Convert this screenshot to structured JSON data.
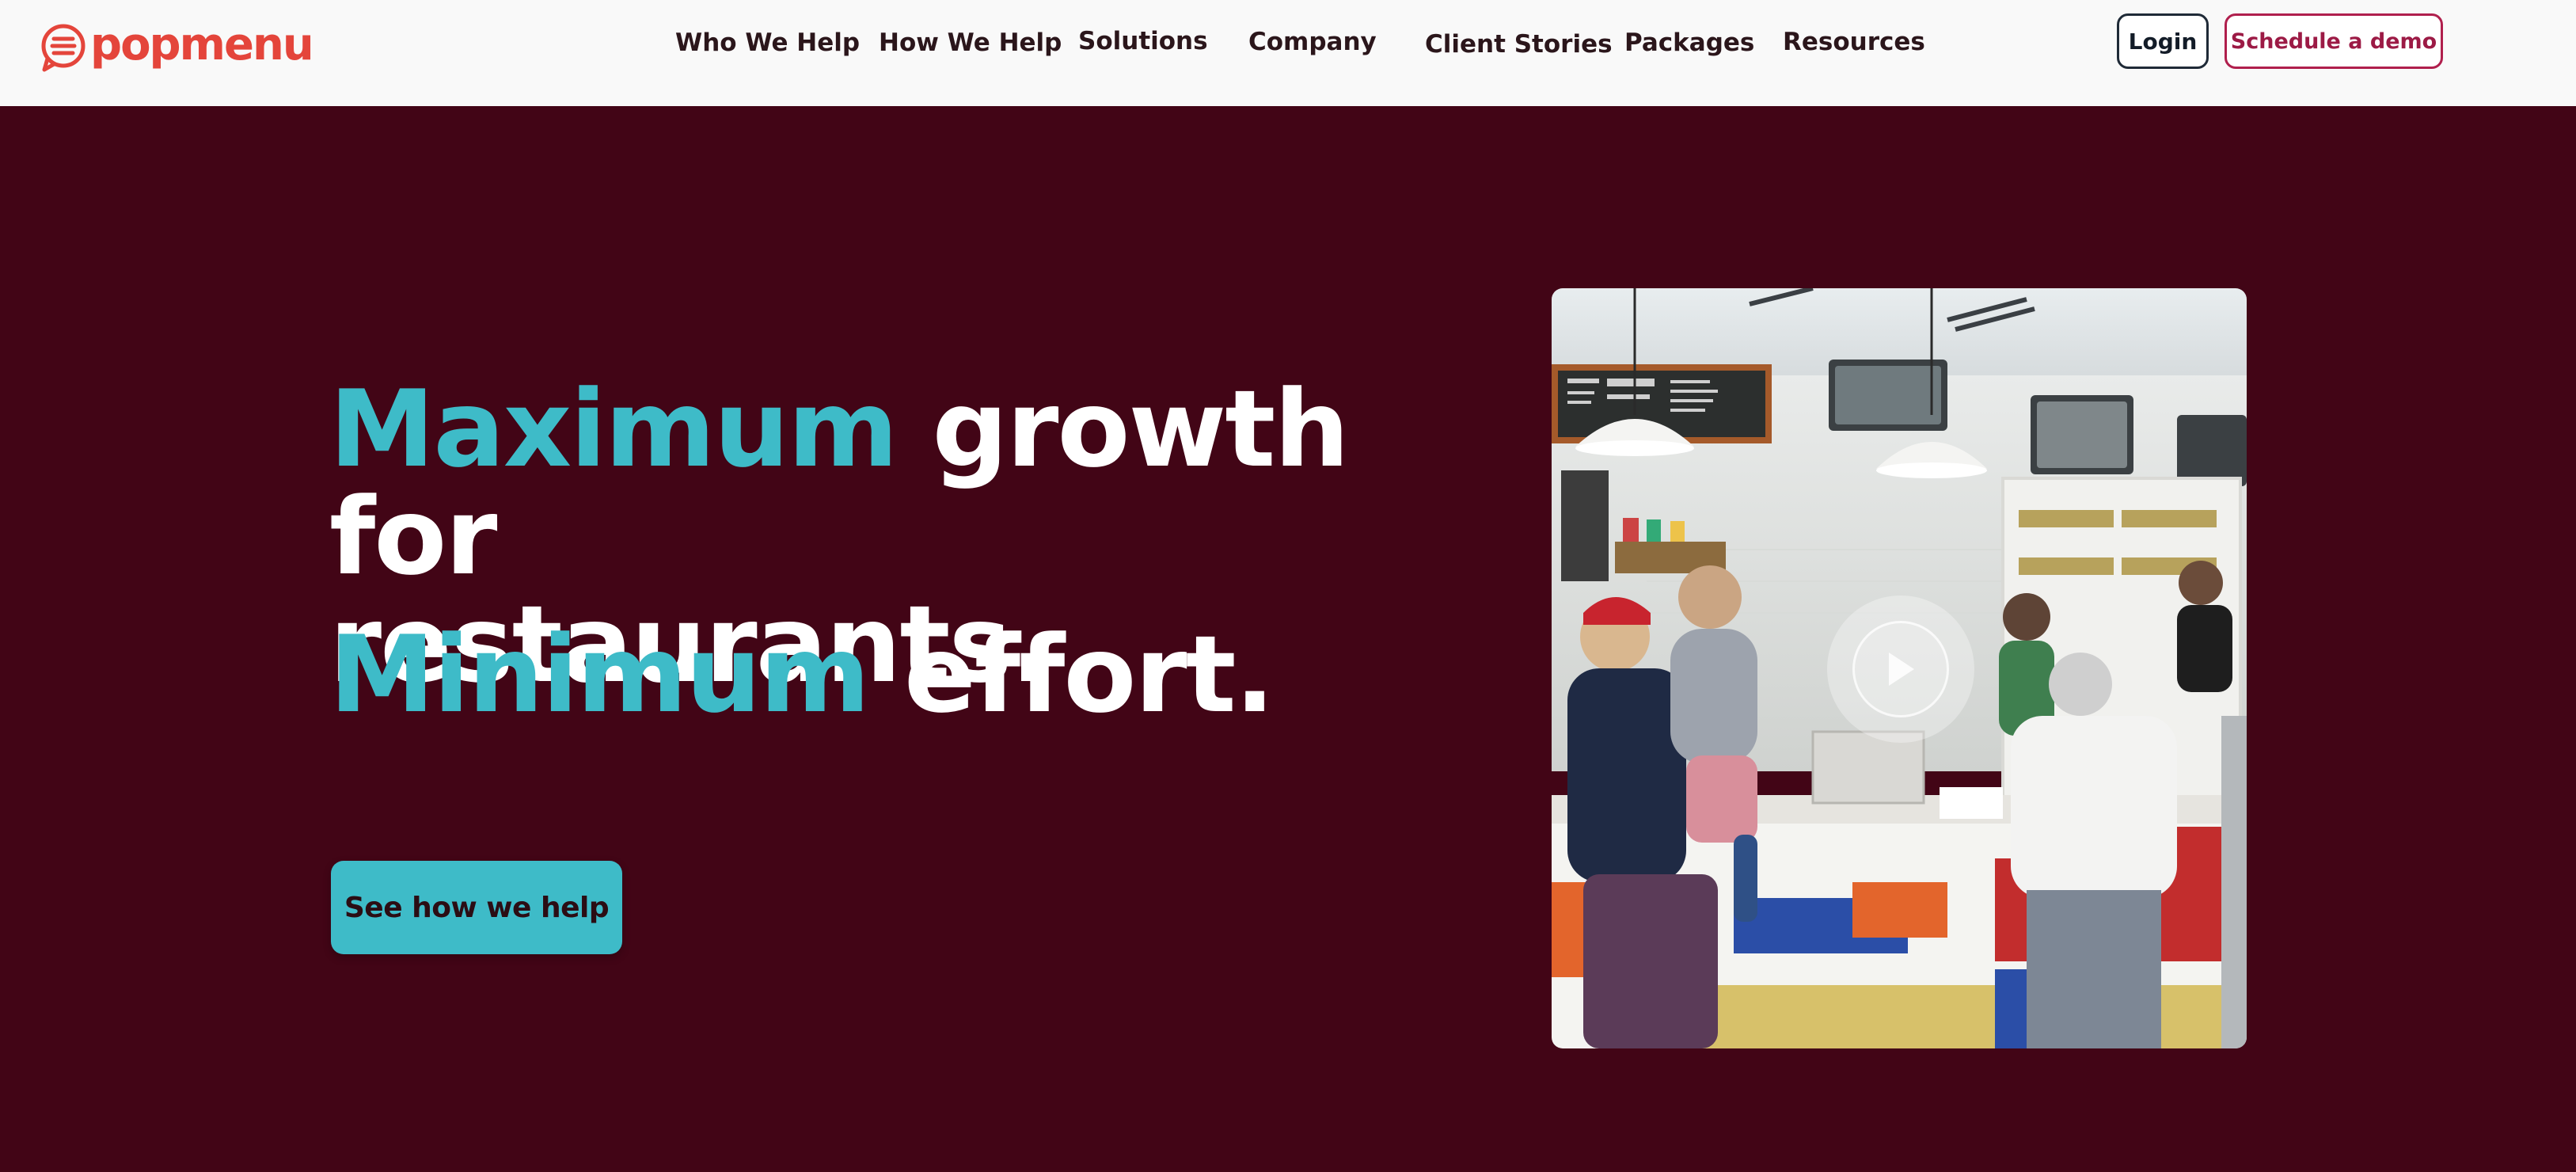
{
  "header": {
    "logo_text": "popmenu",
    "logo_icon": "menu-speech-bubble-icon",
    "nav": [
      {
        "label": "Who We Help"
      },
      {
        "label": "How We Help"
      },
      {
        "label": "Solutions"
      },
      {
        "label": "Company"
      },
      {
        "label": "Client Stories"
      },
      {
        "label": "Packages"
      },
      {
        "label": "Resources"
      }
    ],
    "login_label": "Login",
    "demo_label": "Schedule a demo"
  },
  "hero": {
    "headline_accent": "Maximum",
    "headline_rest_line1": "growth for",
    "headline_rest_line2": "restaurants.",
    "subline_accent": "Minimum",
    "subline_rest": "effort.",
    "cta_label": "See how we help",
    "video": {
      "play_icon": "play-icon"
    }
  },
  "colors": {
    "brand": "#e4453b",
    "hero_background": "#420516",
    "accent": "#3ebbc8",
    "demo_border": "#b01f4d"
  }
}
